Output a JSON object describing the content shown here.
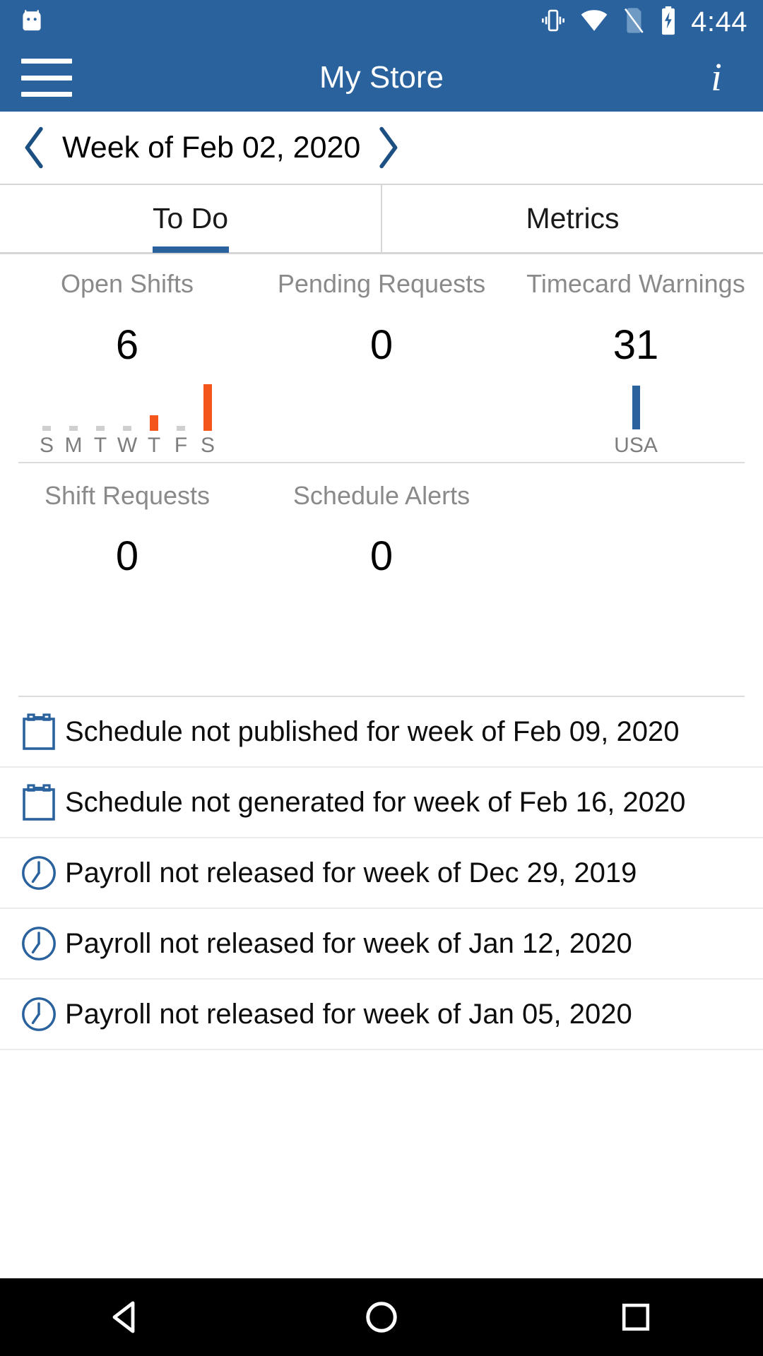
{
  "theme": {
    "brand_blue": "#2a629e",
    "orange": "#f4551b",
    "gray_bar": "#cfcfcf",
    "label_gray": "#8a8a8a",
    "divider": "#dcdcdc"
  },
  "status_bar": {
    "time": "4:44",
    "icons": [
      "android-robot-icon",
      "vibrate-icon",
      "wifi-icon",
      "no-sim-icon",
      "battery-charging-icon"
    ]
  },
  "app_bar": {
    "menu_icon": "hamburger-menu-icon",
    "title": "My Store",
    "info_icon": "info-icon",
    "info_glyph": "i"
  },
  "week_nav": {
    "prev_icon": "chevron-left-icon",
    "label": "Week of Feb 02, 2020",
    "next_icon": "chevron-right-icon"
  },
  "tabs": [
    {
      "label": "To Do",
      "active": true
    },
    {
      "label": "Metrics",
      "active": false
    }
  ],
  "metrics": {
    "row1": [
      {
        "label": "Open Shifts",
        "value": "6",
        "chart": "week"
      },
      {
        "label": "Pending Requests",
        "value": "0",
        "chart": "none"
      },
      {
        "label": "Timecard Warnings",
        "value": "31",
        "chart": "single"
      }
    ],
    "row2": [
      {
        "label": "Shift Requests",
        "value": "0"
      },
      {
        "label": "Schedule Alerts",
        "value": "0"
      }
    ]
  },
  "chart_data": [
    {
      "type": "bar",
      "title": "Open Shifts",
      "categories": [
        "S",
        "M",
        "T",
        "W",
        "T",
        "F",
        "S"
      ],
      "values": [
        0.3,
        0.3,
        0.3,
        0.3,
        2,
        0.3,
        6
      ],
      "colors": [
        "#cfcfcf",
        "#cfcfcf",
        "#cfcfcf",
        "#cfcfcf",
        "#f4551b",
        "#cfcfcf",
        "#f4551b"
      ],
      "ylim": [
        0,
        6
      ],
      "xlabel": "",
      "ylabel": "",
      "grid": false,
      "legend": "none"
    },
    {
      "type": "bar",
      "title": "Timecard Warnings",
      "categories": [
        "USA"
      ],
      "values": [
        31
      ],
      "colors": [
        "#2a629e"
      ],
      "ylim": [
        0,
        31
      ],
      "xlabel": "",
      "ylabel": "",
      "grid": false,
      "legend": "none"
    }
  ],
  "todo_items": [
    {
      "icon": "calendar-icon",
      "text": "Schedule not published for week of Feb 09, 2020"
    },
    {
      "icon": "calendar-icon",
      "text": "Schedule not generated for week of Feb 16, 2020"
    },
    {
      "icon": "clock-icon",
      "text": "Payroll not released for week of Dec 29, 2019"
    },
    {
      "icon": "clock-icon",
      "text": "Payroll not released for week of Jan 12, 2020"
    },
    {
      "icon": "clock-icon",
      "text": "Payroll not released for week of Jan 05, 2020"
    }
  ],
  "nav_bar": {
    "back_icon": "back-triangle-icon",
    "home_icon": "home-circle-icon",
    "recents_icon": "recents-square-icon"
  }
}
